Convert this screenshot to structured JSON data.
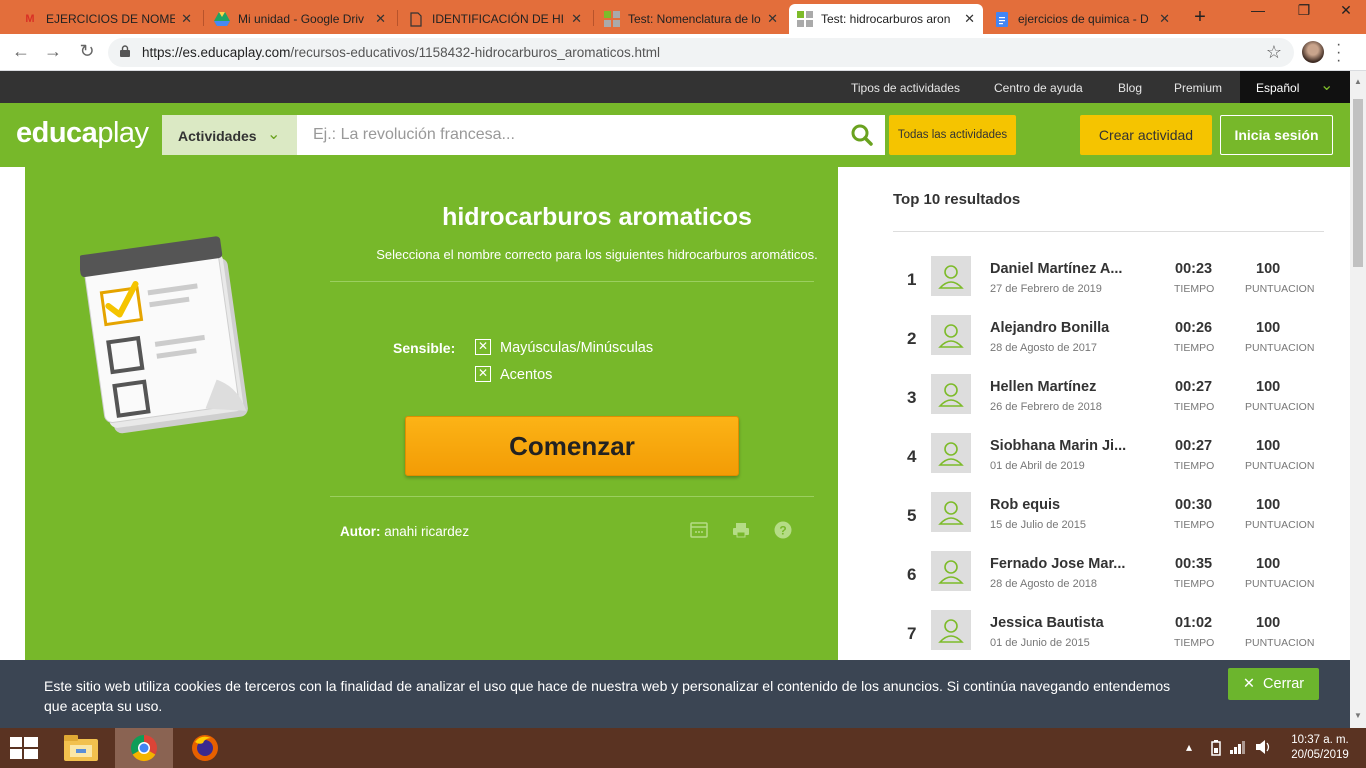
{
  "browser": {
    "tabs": [
      {
        "title": "EJERCICIOS DE NOMENC",
        "icon": "gmail-icon"
      },
      {
        "title": "Mi unidad - Google Driv",
        "icon": "drive-icon"
      },
      {
        "title": "IDENTIFICACIÓN DE HID",
        "icon": "document-icon"
      },
      {
        "title": "Test: Nomenclatura de lo",
        "icon": "educaplay-icon"
      },
      {
        "title": "Test: hidrocarburos aron",
        "icon": "educaplay-icon",
        "active": true
      },
      {
        "title": "ejercicios de quimica - D",
        "icon": "docs-icon"
      }
    ],
    "url_host": "https://es.educaplay.com",
    "url_path": "/recursos-educativos/1158432-hidrocarburos_aromaticos.html"
  },
  "topnav": {
    "links": [
      "Tipos de actividades",
      "Centro de ayuda",
      "Blog",
      "Premium"
    ],
    "language": "Español"
  },
  "header": {
    "logo_a": "educa",
    "logo_b": "play",
    "category": "Actividades",
    "search_placeholder": "Ej.: La revolución francesa...",
    "all_activities": "Todas las actividades",
    "create": "Crear actividad",
    "login": "Inicia sesión"
  },
  "activity": {
    "title": "hidrocarburos aromaticos",
    "description": "Selecciona el nombre correcto para los siguientes hidrocarburos aromáticos.",
    "sensitive_label": "Sensible:",
    "option_case": "Mayúsculas/Minúsculas",
    "option_accents": "Acentos",
    "start": "Comenzar",
    "author_label": "Autor:",
    "author": "anahi ricardez"
  },
  "ranking": {
    "title": "Top 10 resultados",
    "time_label": "TIEMPO",
    "score_label": "PUNTUACION",
    "rows": [
      {
        "rank": "1",
        "name": "Daniel Martínez A...",
        "date": "27 de Febrero de 2019",
        "time": "00:23",
        "score": "100"
      },
      {
        "rank": "2",
        "name": "Alejandro Bonilla",
        "date": "28 de Agosto de 2017",
        "time": "00:26",
        "score": "100"
      },
      {
        "rank": "3",
        "name": "Hellen Martínez",
        "date": "26 de Febrero de 2018",
        "time": "00:27",
        "score": "100"
      },
      {
        "rank": "4",
        "name": "Siobhana Marin Ji...",
        "date": "01 de Abril de 2019",
        "time": "00:27",
        "score": "100"
      },
      {
        "rank": "5",
        "name": "Rob equis",
        "date": "15 de Julio de 2015",
        "time": "00:30",
        "score": "100"
      },
      {
        "rank": "6",
        "name": "Fernado Jose Mar...",
        "date": "28 de Agosto de 2018",
        "time": "00:35",
        "score": "100"
      },
      {
        "rank": "7",
        "name": "Jessica Bautista",
        "date": "01 de Junio de 2015",
        "time": "01:02",
        "score": "100"
      }
    ]
  },
  "cookie": {
    "text": "Este sitio web utiliza cookies de terceros con la finalidad de analizar el uso que hace de nuestra web y personalizar el contenido de los anuncios. Si continúa navegando entendemos que acepta su uso.",
    "close": "Cerrar"
  },
  "taskbar": {
    "time": "10:37 a. m.",
    "date": "20/05/2019"
  },
  "colors": {
    "brand_green": "#77b82a",
    "accent_yellow": "#f5c400",
    "start_orange": "#f39c05",
    "tab_strip": "#e36e3b"
  }
}
